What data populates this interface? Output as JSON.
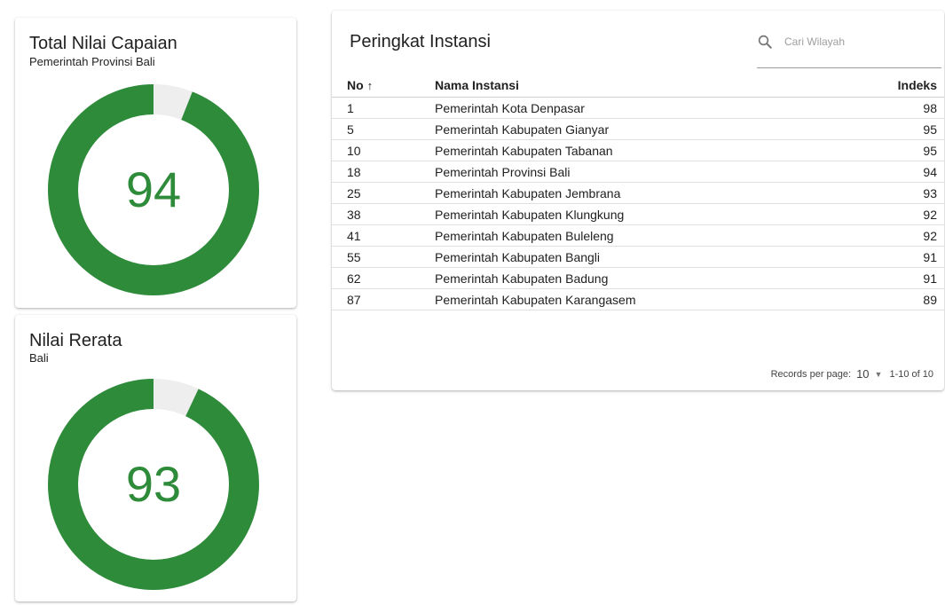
{
  "total_card": {
    "title": "Total Nilai Capaian",
    "subtitle": "Pemerintah Provinsi Bali",
    "value": "94",
    "progress_percent": 94
  },
  "rerata_card": {
    "title": "Nilai Rerata",
    "subtitle": "Bali",
    "value": "93",
    "progress_percent": 93
  },
  "colors": {
    "gauge_fill": "#2e8b3a",
    "gauge_track": "#eeeeee"
  },
  "ranking": {
    "title": "Peringkat Instansi",
    "search_placeholder": "Cari Wilayah",
    "columns": {
      "no": "No",
      "sort_indicator": "↑",
      "name": "Nama Instansi",
      "index": "Indeks"
    },
    "rows": [
      {
        "no": "1",
        "name": "Pemerintah Kota Denpasar",
        "index": "98"
      },
      {
        "no": "5",
        "name": "Pemerintah Kabupaten Gianyar",
        "index": "95"
      },
      {
        "no": "10",
        "name": "Pemerintah Kabupaten Tabanan",
        "index": "95"
      },
      {
        "no": "18",
        "name": "Pemerintah Provinsi Bali",
        "index": "94"
      },
      {
        "no": "25",
        "name": "Pemerintah Kabupaten Jembrana",
        "index": "93"
      },
      {
        "no": "38",
        "name": "Pemerintah Kabupaten Klungkung",
        "index": "92"
      },
      {
        "no": "41",
        "name": "Pemerintah Kabupaten Buleleng",
        "index": "92"
      },
      {
        "no": "55",
        "name": "Pemerintah Kabupaten Bangli",
        "index": "91"
      },
      {
        "no": "62",
        "name": "Pemerintah Kabupaten Badung",
        "index": "91"
      },
      {
        "no": "87",
        "name": "Pemerintah Kabupaten Karangasem",
        "index": "89"
      }
    ],
    "footer": {
      "records_per_page_label": "Records per page:",
      "records_per_page_value": "10",
      "range": "1-10 of 10"
    }
  }
}
